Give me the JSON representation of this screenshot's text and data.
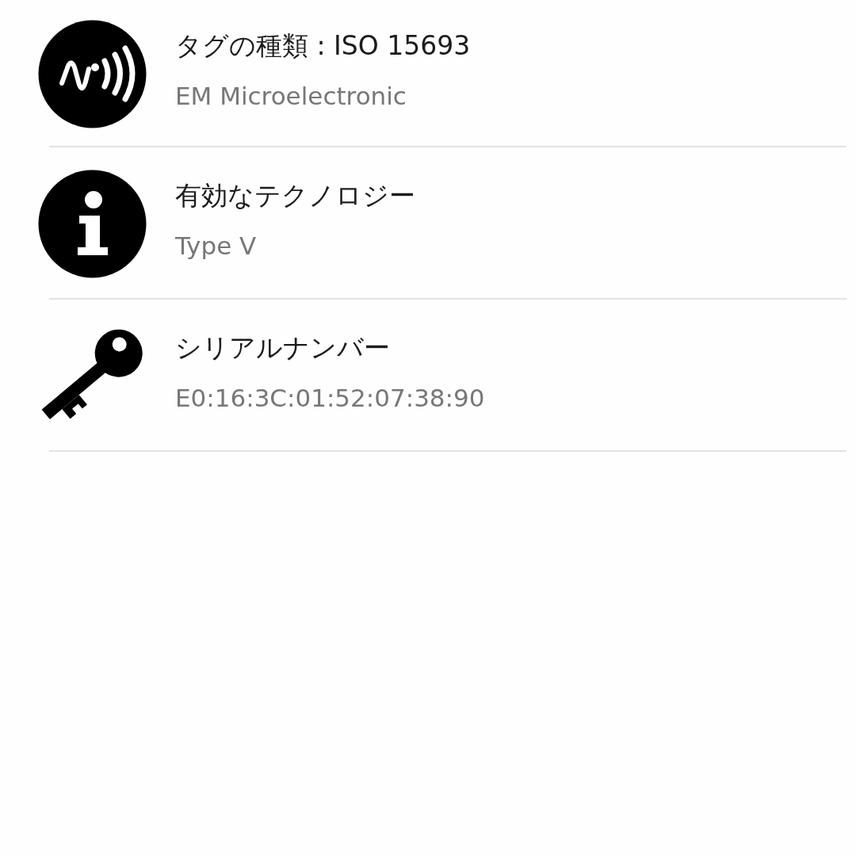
{
  "rows": [
    {
      "kind": "nfc",
      "title": "タグの種類 : ISO 15693",
      "subtitle": "EM Microelectronic"
    },
    {
      "kind": "info",
      "title": "有効なテクノロジー",
      "subtitle": "Type V"
    },
    {
      "kind": "key",
      "title": "シリアルナンバー",
      "subtitle": "E0:16:3C:01:52:07:38:90"
    }
  ]
}
